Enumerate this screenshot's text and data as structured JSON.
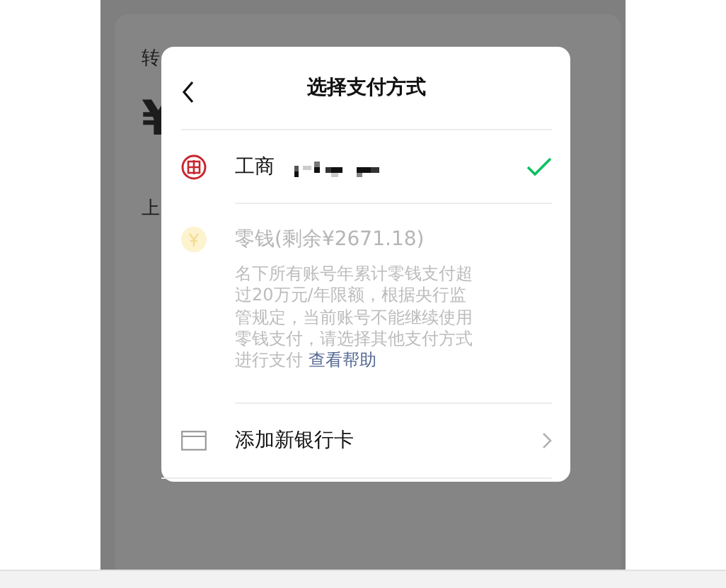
{
  "background": {
    "label": "转",
    "amount_symbol": "¥",
    "note": "上"
  },
  "dialog": {
    "title": "选择支付方式",
    "methods": [
      {
        "kind": "bank",
        "name": "工商",
        "selected": true,
        "disabled": false
      },
      {
        "kind": "balance",
        "name": "零钱(剩余¥2671.18)",
        "selected": false,
        "disabled": true,
        "notice": "名下所有账号年累计零钱支付超过20万元/年限额，根据央行监管规定，当前账号不能继续使用零钱支付，请选择其他支付方式进行支付",
        "help_link": "查看帮助"
      }
    ],
    "add_card": {
      "label": "添加新银行卡"
    }
  }
}
